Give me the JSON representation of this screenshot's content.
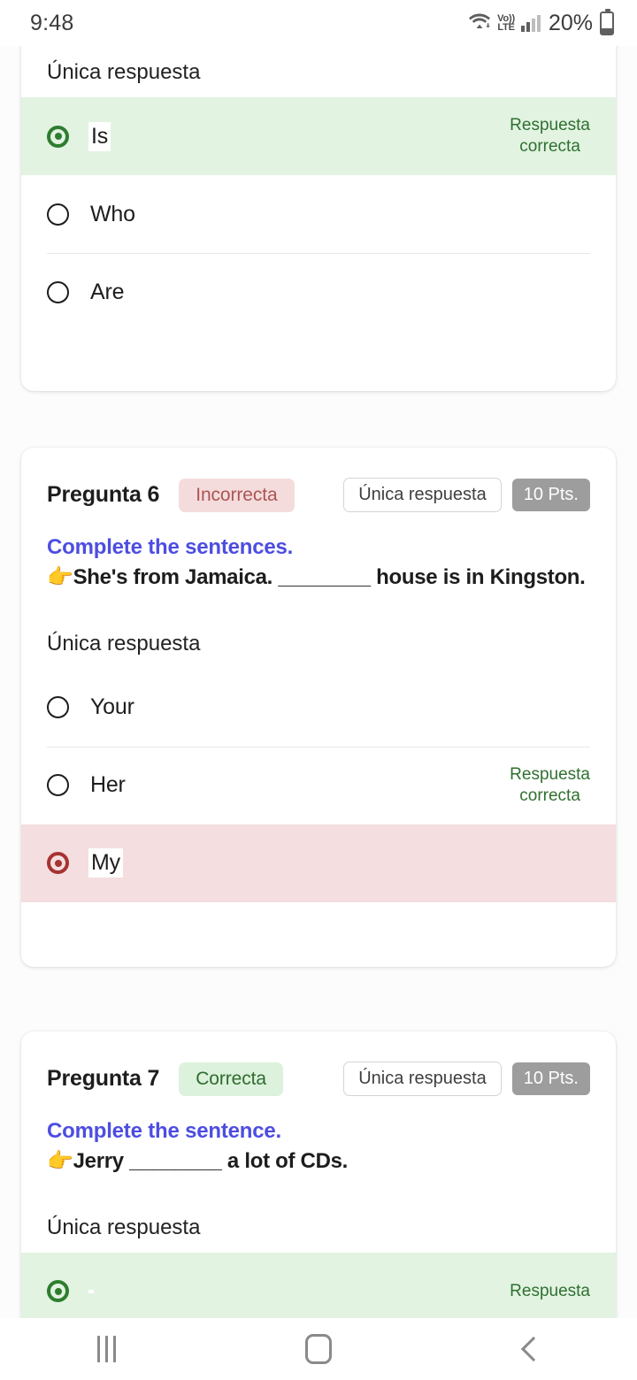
{
  "status_bar": {
    "time": "9:48",
    "network_label_top": "Vo))",
    "network_label_bottom": "LTE",
    "battery_percent": "20%",
    "icons": [
      "wifi-icon",
      "volte-icon",
      "signal-bars-icon",
      "battery-icon"
    ]
  },
  "cards": [
    {
      "id": "question-5-partial",
      "answer_type_label": "Única respuesta",
      "options": [
        {
          "label": "Is",
          "state": "selected-correct",
          "note": "Respuesta\ncorrecta",
          "divider": false
        },
        {
          "label": "Who",
          "state": "unselected",
          "note": "",
          "divider": false
        },
        {
          "label": "Are",
          "state": "unselected",
          "note": "",
          "divider": true
        }
      ]
    },
    {
      "id": "question-6",
      "title": "Pregunta 6",
      "result_badge": "Incorrecta",
      "result_state": "incorrect",
      "type_chip": "Única respuesta",
      "points_badge": "10 Pts.",
      "prompt_heading": "Complete the sentences.",
      "prompt_emoji": "👉",
      "prompt_sentence": "She's from Jamaica. ________ house is in Kingston.",
      "answer_type_label": "Única respuesta",
      "options": [
        {
          "label": "Your",
          "state": "unselected",
          "note": "",
          "divider": false
        },
        {
          "label": "Her",
          "state": "unselected",
          "note": "Respuesta\ncorrecta",
          "divider": true
        },
        {
          "label": "My",
          "state": "selected-wrong",
          "note": "",
          "divider": false
        }
      ]
    },
    {
      "id": "question-7",
      "title": "Pregunta 7",
      "result_badge": "Correcta",
      "result_state": "correct",
      "type_chip": "Única respuesta",
      "points_badge": "10 Pts.",
      "prompt_heading": "Complete the sentence.",
      "prompt_emoji": "👉",
      "prompt_sentence": "Jerry ________ a lot of CDs.",
      "answer_type_label": "Única respuesta",
      "options": [
        {
          "label": "",
          "state": "selected-correct",
          "note": "Respuesta",
          "divider": false
        }
      ]
    }
  ],
  "nav_bar": {
    "recents_label": "recents-button",
    "home_label": "home-button",
    "back_label": "back-button"
  },
  "colors": {
    "correct_bg": "#e2f3e2",
    "correct_text": "#2f7030",
    "wrong_bg": "#f4dedf",
    "wrong_text": "#ab5555",
    "prompt_accent": "#4d4de2",
    "points_badge_bg": "#9d9d9d",
    "page_bg": "#fcfcfc"
  }
}
